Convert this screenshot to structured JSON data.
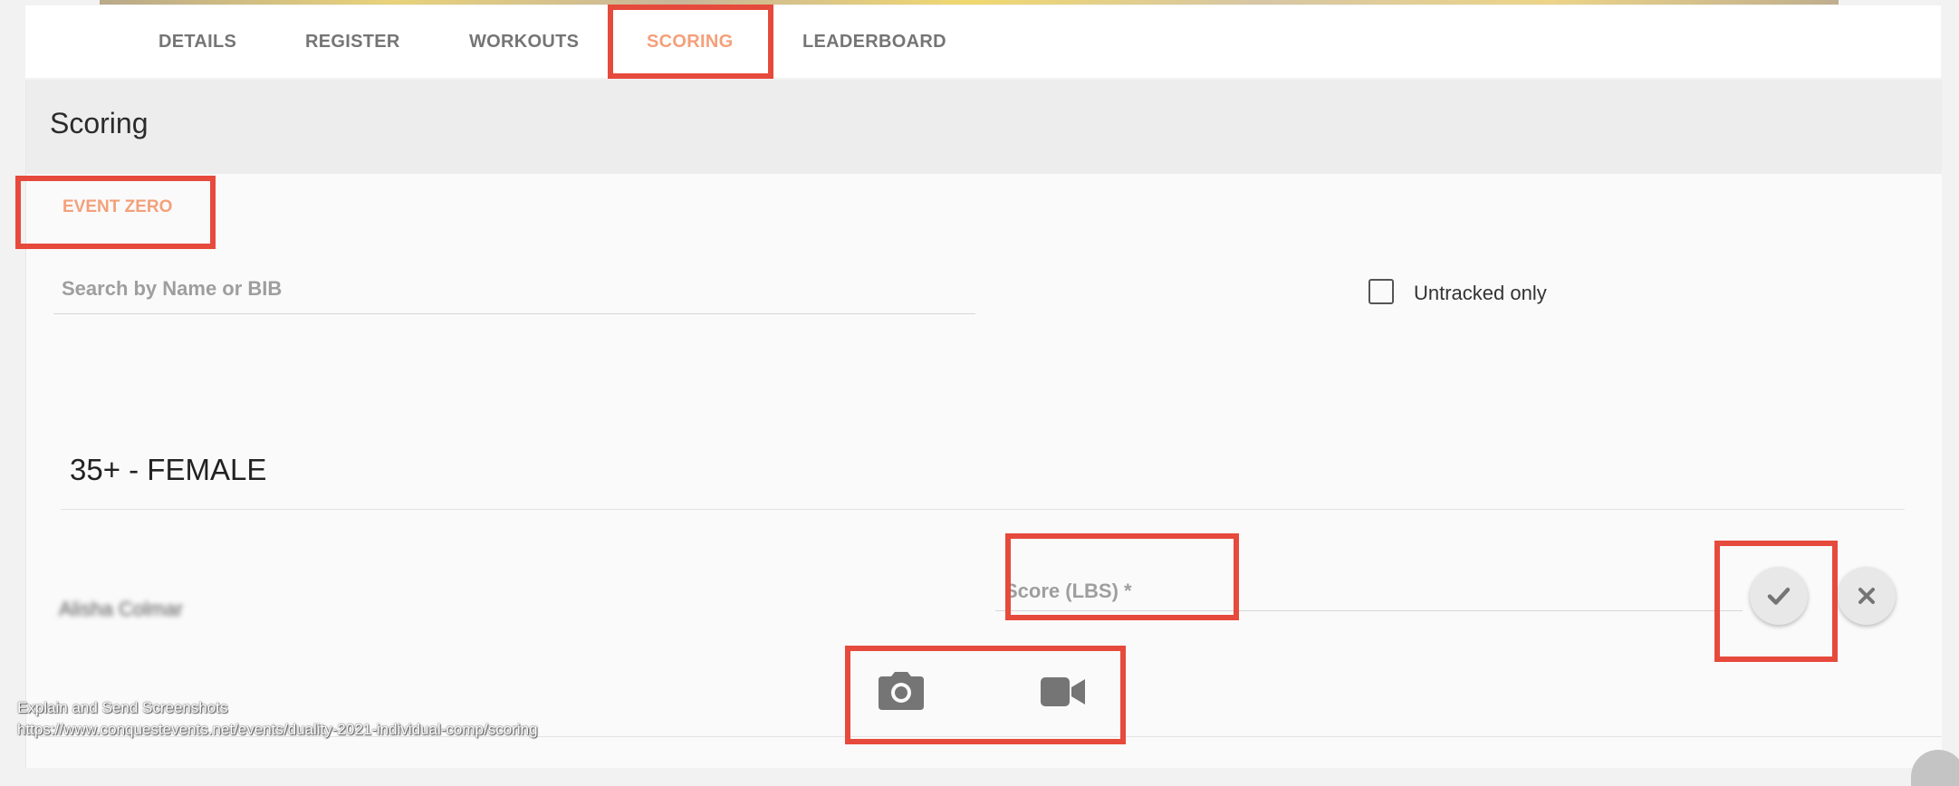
{
  "nav": {
    "tabs": [
      {
        "label": "DETAILS"
      },
      {
        "label": "REGISTER"
      },
      {
        "label": "WORKOUTS"
      },
      {
        "label": "SCORING"
      },
      {
        "label": "LEADERBOARD"
      }
    ],
    "active_tab": "SCORING"
  },
  "scoring": {
    "title": "Scoring",
    "event_tab": "EVENT ZERO",
    "search": {
      "placeholder": "Search by Name or BIB",
      "value": ""
    },
    "filter": {
      "label": "Untracked only",
      "checked": false
    },
    "division": {
      "title": "35+ - FEMALE",
      "athletes": [
        {
          "name": "Alisha Colmar",
          "score_placeholder": "Score (LBS) *",
          "score_value": ""
        }
      ]
    }
  },
  "icons": {
    "confirm": "check-icon",
    "cancel": "close-icon",
    "photo": "camera-icon",
    "video": "video-camera-icon"
  },
  "overlay": {
    "caption": "Explain and Send Screenshots",
    "url": "https://www.conquestevents.net/events/duality-2021-individual-comp/scoring"
  },
  "colors": {
    "accent": "#f4a07a",
    "highlight": "#e64a3c",
    "icon_gray": "#757575"
  }
}
